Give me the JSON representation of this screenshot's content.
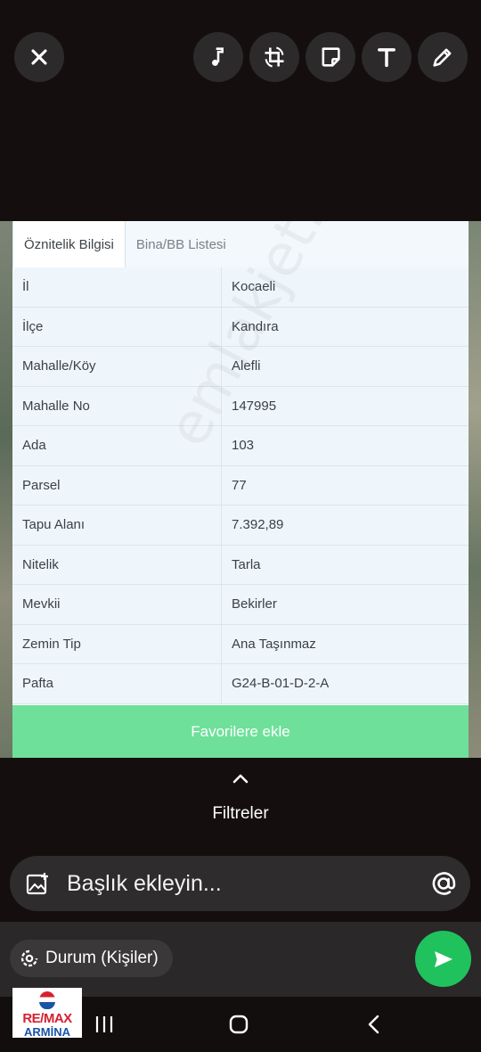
{
  "editor": {
    "close_icon": "close-icon",
    "tools": [
      "music-note-icon",
      "crop-rotate-icon",
      "sticker-icon",
      "text-tool-icon",
      "pencil-icon"
    ]
  },
  "screenshot": {
    "tabs": [
      {
        "label": "Öznitelik Bilgisi",
        "active": true
      },
      {
        "label": "Bina/BB Listesi",
        "active": false
      }
    ],
    "rows": [
      {
        "key": "İl",
        "value": "Kocaeli"
      },
      {
        "key": "İlçe",
        "value": "Kandıra"
      },
      {
        "key": "Mahalle/Köy",
        "value": "Alefli"
      },
      {
        "key": "Mahalle No",
        "value": "147995"
      },
      {
        "key": "Ada",
        "value": "103"
      },
      {
        "key": "Parsel",
        "value": "77"
      },
      {
        "key": "Tapu Alanı",
        "value": "7.392,89"
      },
      {
        "key": "Nitelik",
        "value": "Tarla"
      },
      {
        "key": "Mevkii",
        "value": "Bekirler"
      },
      {
        "key": "Zemin Tip",
        "value": "Ana Taşınmaz"
      },
      {
        "key": "Pafta",
        "value": "G24-B-01-D-2-A"
      }
    ],
    "favorite_button": "Favorilere ekle",
    "watermark": "emlakjet.com"
  },
  "filters": {
    "label": "Filtreler"
  },
  "caption": {
    "placeholder": "Başlık ekleyin..."
  },
  "status": {
    "label": "Durum (Kişiler)"
  },
  "logo": {
    "brand": "RE/MAX",
    "sub": "ARMİNA"
  },
  "colors": {
    "accent_green": "#20c25e",
    "favorite_green": "#6ee09a"
  }
}
